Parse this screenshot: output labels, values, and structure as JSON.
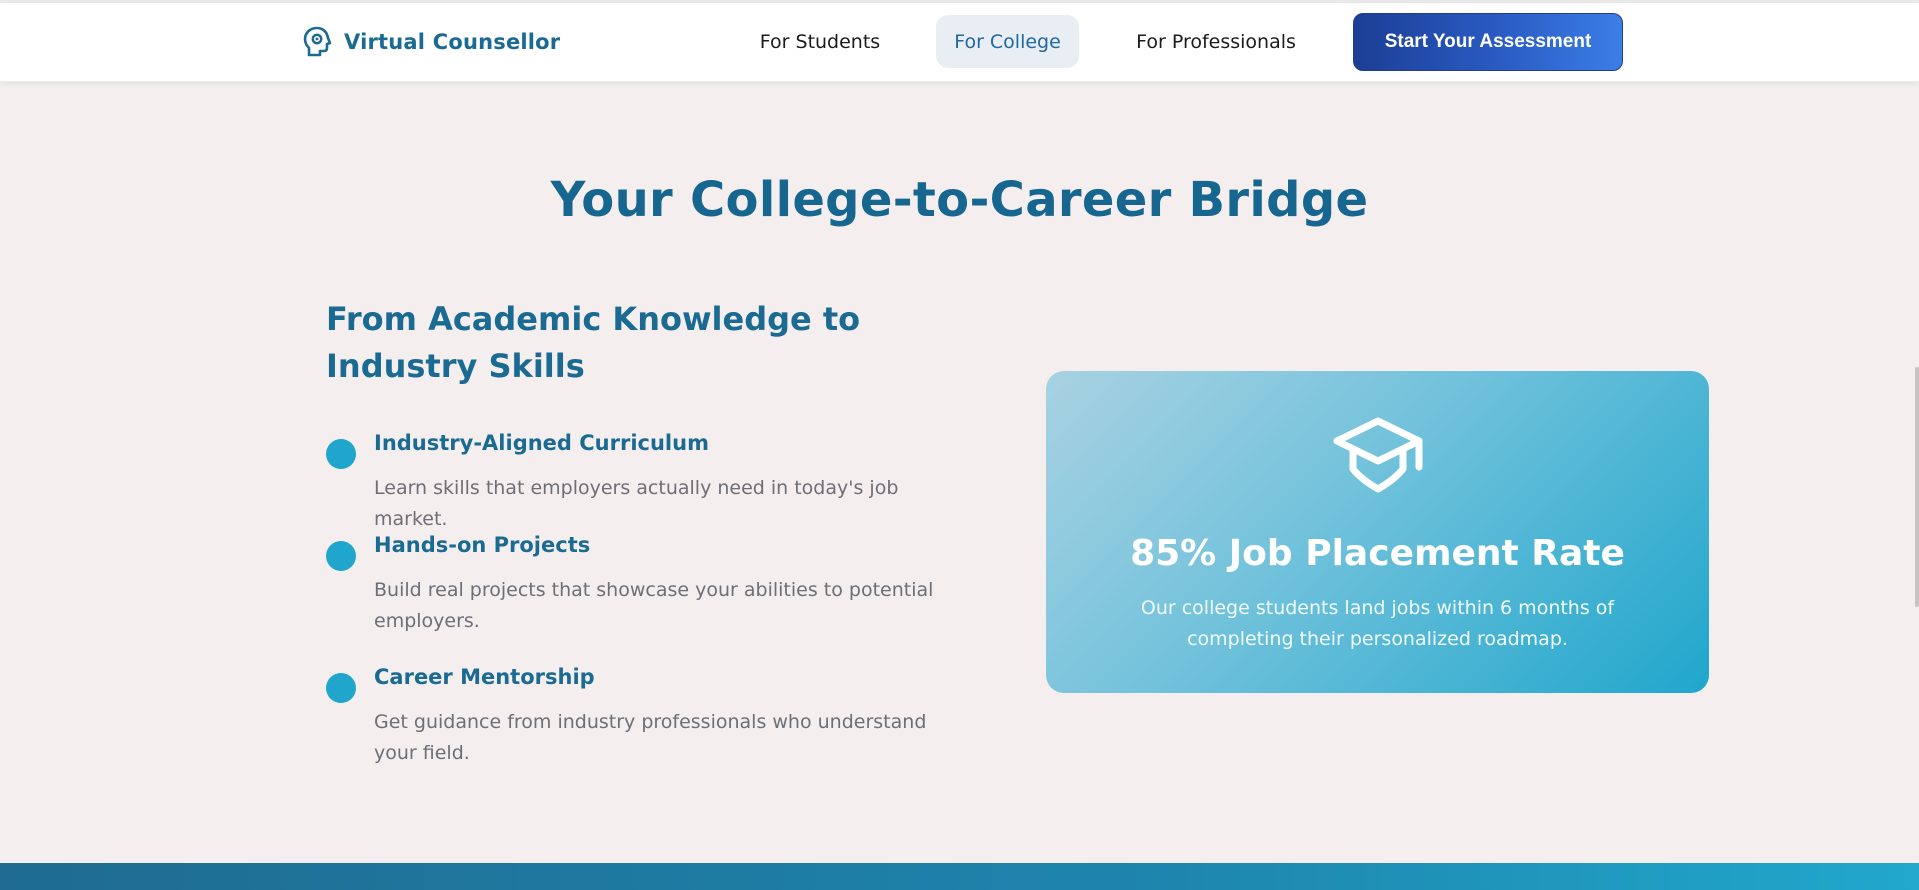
{
  "brand": {
    "name": "Virtual Counsellor",
    "icon": "brain-gear-icon"
  },
  "nav": {
    "items": [
      {
        "label": "For Students",
        "active": false
      },
      {
        "label": "For College",
        "active": true
      },
      {
        "label": "For Professionals",
        "active": false
      }
    ],
    "cta_label": "Start Your Assessment"
  },
  "section": {
    "title": "Your College-to-Career Bridge",
    "subtitle": "From Academic Knowledge to Industry Skills",
    "features": [
      {
        "title": "Industry-Aligned Curriculum",
        "description": "Learn skills that employers actually need in today's job market."
      },
      {
        "title": "Hands-on Projects",
        "description": "Build real projects that showcase your abilities to potential employers."
      },
      {
        "title": "Career Mentorship",
        "description": "Get guidance from industry professionals who understand your field."
      }
    ]
  },
  "stat_card": {
    "icon": "graduation-cap-icon",
    "title": "85% Job Placement Rate",
    "description": "Our college students land jobs within 6 months of completing their personalized roadmap."
  },
  "colors": {
    "brand": "#1a6a92",
    "accent": "#20a6cc",
    "cta_start": "#1c3e95",
    "cta_end": "#3b7ee6",
    "page_bg": "#f4efee"
  }
}
